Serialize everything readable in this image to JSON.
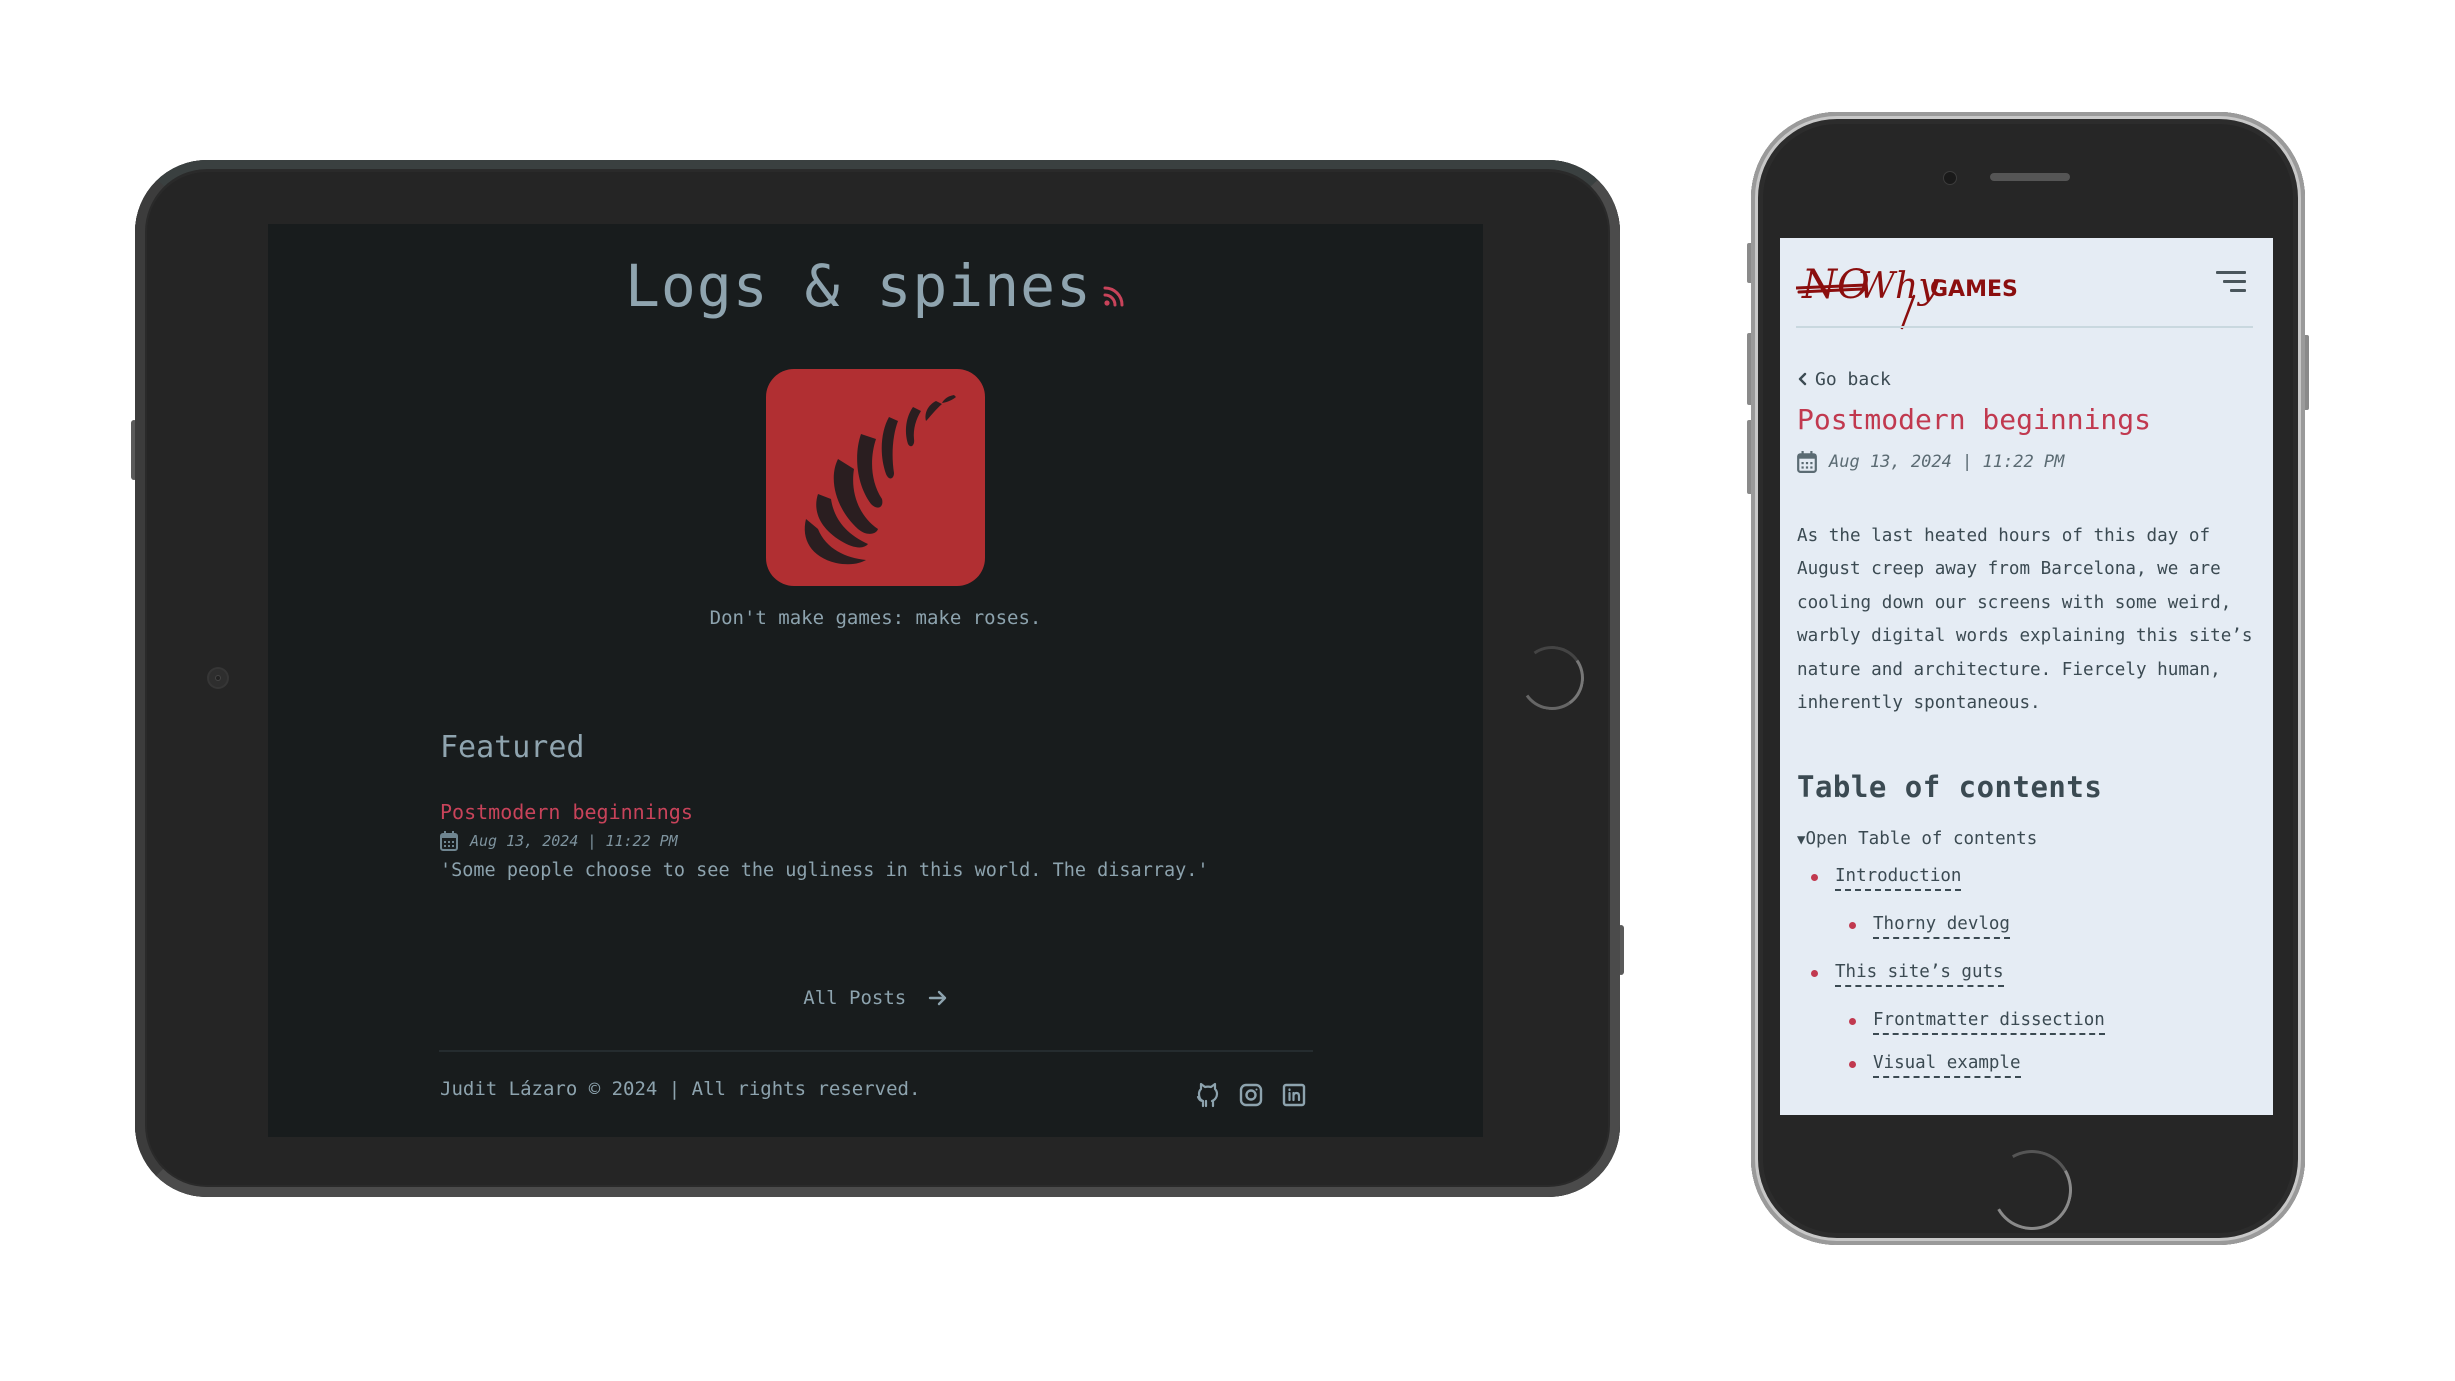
{
  "tablet": {
    "site_title": "Logs & spines",
    "rss_icon": "rss-icon",
    "logo_icon": "rose-thorn-logo",
    "tagline": "Don't make games: make roses.",
    "featured": {
      "heading": "Featured",
      "posts": [
        {
          "title": "Postmodern beginnings",
          "date": "Aug 13, 2024 | 11:22 PM",
          "description": "'Some people choose to see the ugliness in this world. The disarray.'"
        }
      ]
    },
    "all_posts_label": "All Posts",
    "all_posts_icon": "arrow-right-icon",
    "footer": {
      "copyright": "Judit Lázaro © 2024 | All rights reserved.",
      "social": [
        {
          "name": "github",
          "icon": "github-icon"
        },
        {
          "name": "instagram",
          "icon": "instagram-icon"
        },
        {
          "name": "linkedin",
          "icon": "linkedin-icon"
        }
      ]
    },
    "colors": {
      "background": "#181c1d",
      "text": "#8da3ae",
      "accent": "#c8435a",
      "logo_tile": "#b12f32"
    }
  },
  "phone": {
    "logo": {
      "struck": "NO",
      "word": "Why",
      "suffix": "GAMES"
    },
    "menu_icon": "hamburger-menu-icon",
    "go_back_label": "Go back",
    "post": {
      "title": "Postmodern beginnings",
      "date": "Aug 13, 2024 | 11:22 PM",
      "body": "As the last heated hours of this day of August creep away from Barcelona, we are cooling down our screens with some weird, warbly digital words explaining this site’s nature and architecture. Fiercely human, inherently spontaneous."
    },
    "toc": {
      "heading": "Table of contents",
      "toggle_label": "Open Table of contents",
      "items": [
        {
          "label": "Introduction",
          "level": 1
        },
        {
          "label": "Thorny devlog",
          "level": 2
        },
        {
          "label": "This site’s guts",
          "level": 1
        },
        {
          "label": "Frontmatter dissection",
          "level": 2
        },
        {
          "label": "Visual example",
          "level": 2
        }
      ]
    },
    "colors": {
      "background": "#e5ecf4",
      "text": "#3b4a52",
      "accent": "#c1394f",
      "logo": "#8b0e0e"
    }
  }
}
